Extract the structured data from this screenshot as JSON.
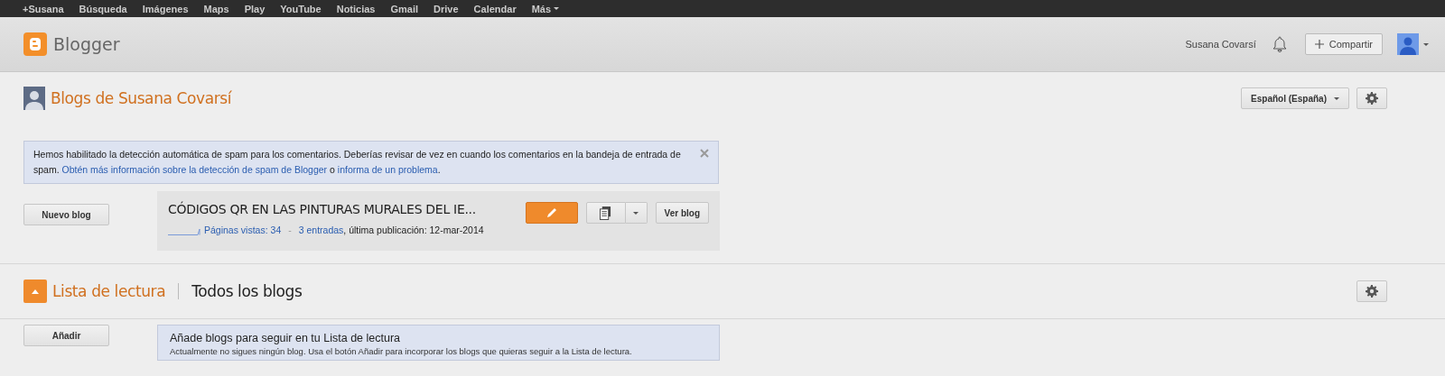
{
  "top_bar": {
    "links": [
      "+Susana",
      "Búsqueda",
      "Imágenes",
      "Maps",
      "Play",
      "YouTube",
      "Noticias",
      "Gmail",
      "Drive",
      "Calendar"
    ],
    "more": "Más"
  },
  "header": {
    "logo_text": "Blogger",
    "user_name": "Susana Covarsí",
    "share_button": "Compartir"
  },
  "blogs_section": {
    "title": "Blogs de Susana Covarsí",
    "language": "Español (España)"
  },
  "notice": {
    "text": "Hemos habilitado la detección automática de spam para los comentarios. Deberías revisar de vez en cuando los comentarios en la bandeja de entrada de spam.",
    "link_1": "Obtén más información sobre la detección de spam de Blogger",
    "connector": "o",
    "link_2": "informa de un problema",
    "end": "."
  },
  "new_blog_button": "Nuevo blog",
  "blog": {
    "title": "CÓDIGOS QR EN LAS PINTURAS MURALES DEL IE...",
    "pageviews": "Páginas vistas: 34",
    "separator": "-",
    "posts": "3 entradas",
    "last_post": ", última publicación: 12-mar-2014",
    "view_button": "Ver blog"
  },
  "reading_list": {
    "title": "Lista de lectura",
    "filter": "Todos los blogs",
    "add_button": "Añadir",
    "callout_title": "Añade blogs para seguir en tu Lista de lectura",
    "callout_text": "Actualmente no sigues ningún blog. Usa el botón Añadir para incorporar los blogs que quieras seguir a la Lista de lectura."
  }
}
